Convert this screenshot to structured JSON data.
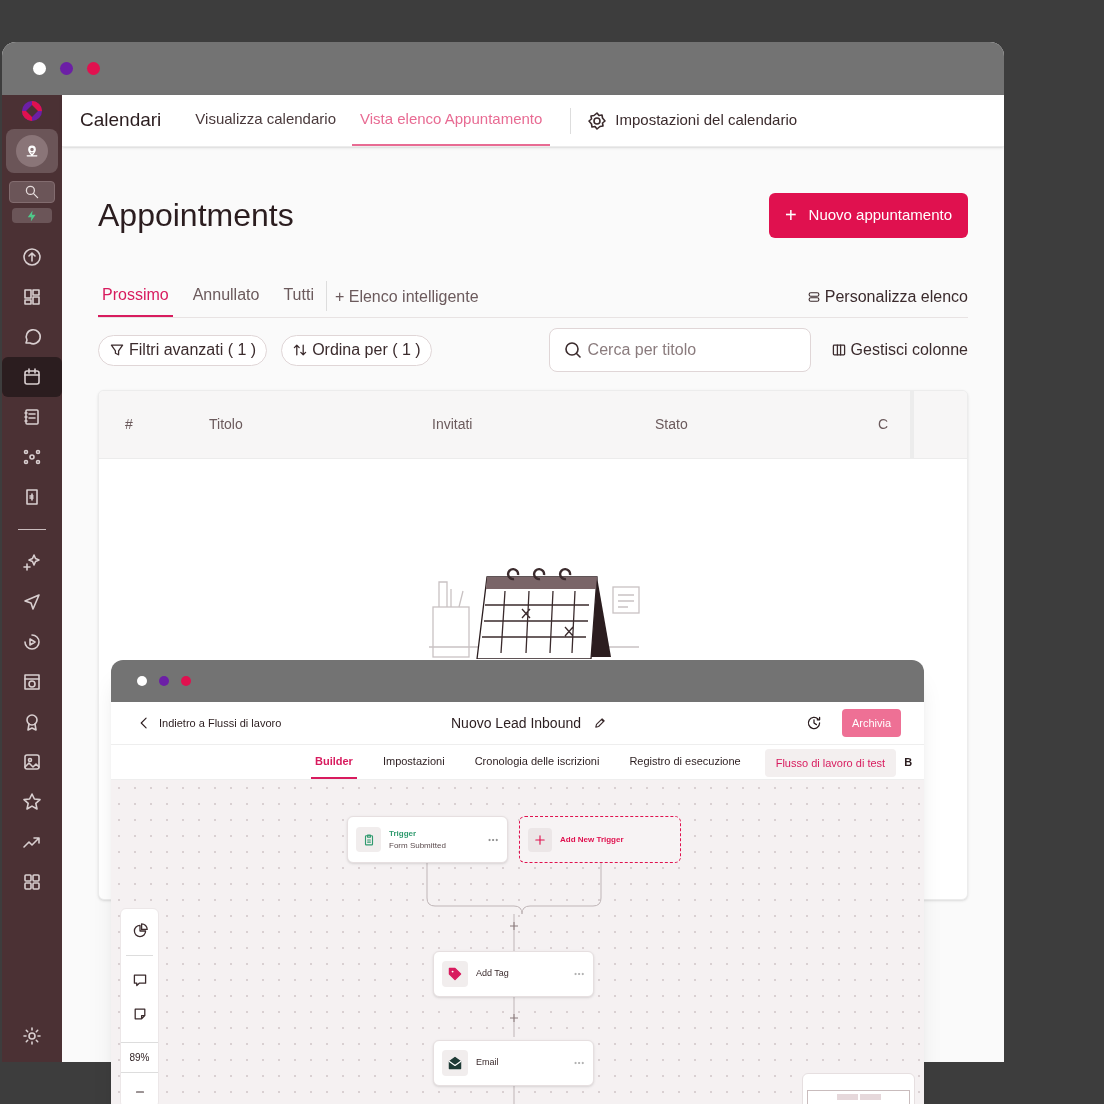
{
  "sidebar": {
    "items": [
      {
        "selected": false
      },
      {
        "selected": false
      },
      {
        "selected": false
      },
      {
        "selected": true
      },
      {
        "selected": false
      },
      {
        "selected": false
      },
      {
        "selected": false
      },
      {
        "selected": false
      },
      {
        "selected": false
      },
      {
        "selected": false
      },
      {
        "selected": false
      },
      {
        "selected": false
      },
      {
        "selected": false
      },
      {
        "selected": false
      },
      {
        "selected": false
      },
      {
        "selected": false
      }
    ]
  },
  "header": {
    "title": "Calendari",
    "tabs": [
      {
        "label": "Visualizza calendario",
        "selected": false
      },
      {
        "label": "Vista elenco Appuntamento",
        "selected": true
      }
    ],
    "settings": "Impostazioni del calendario"
  },
  "page": {
    "title": "Appointments",
    "new_button_icon": "+",
    "new_button": "Nuovo appuntamento"
  },
  "list_tabs": [
    {
      "label": "Prossimo",
      "selected": true
    },
    {
      "label": "Annullato",
      "selected": false
    },
    {
      "label": "Tutti",
      "selected": false
    }
  ],
  "smart_list": "+ Elenco intelligente",
  "customize": "Personalizza elenco",
  "filters": [
    "Filtri avanzati ( 1 )",
    "Ordina per ( 1 )"
  ],
  "search": {
    "placeholder": "Cerca per titolo"
  },
  "manage_columns": "Gestisci colonne",
  "table": {
    "columns": [
      "#",
      "Titolo",
      "Invitati",
      "Stato",
      "C"
    ]
  },
  "workflow": {
    "back": "Indietro a Flussi di lavoro",
    "title": "Nuovo Lead Inbound",
    "archive": "Archivia",
    "tabs": [
      {
        "label": "Builder",
        "selected": true
      },
      {
        "label": "Impostazioni",
        "selected": false
      },
      {
        "label": "Cronologia delle iscrizioni",
        "selected": false
      },
      {
        "label": "Registro di esecuzione",
        "selected": false
      }
    ],
    "test_button": "Flusso di lavoro di test",
    "cut_tab": "B",
    "trigger": {
      "label": "Trigger",
      "detail": "Form Submitted"
    },
    "add_trigger": "Add New Trigger",
    "actions": [
      {
        "kind": "tag",
        "label": "Add Tag"
      },
      {
        "kind": "email",
        "label": "Email"
      }
    ],
    "zoom": "89%"
  }
}
